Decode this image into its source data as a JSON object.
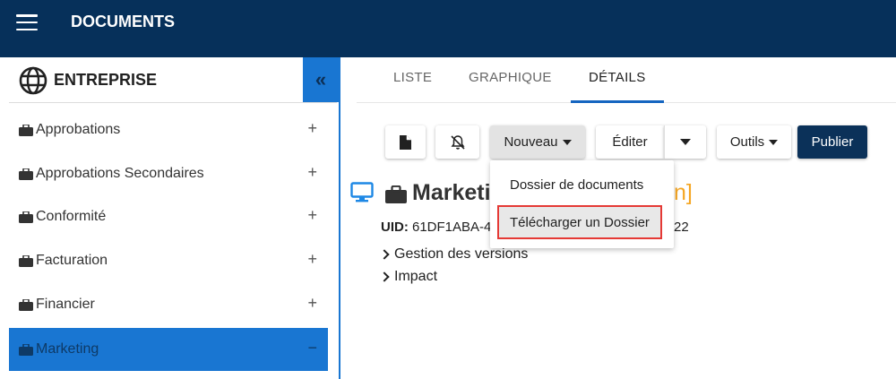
{
  "header": {
    "title": "DOCUMENTS",
    "menu_icon": "hamburger-icon"
  },
  "sidebar": {
    "title": "ENTREPRISE",
    "collapse_label": "«",
    "items": [
      {
        "label": "Approbations",
        "action": "+"
      },
      {
        "label": "Approbations Secondaires",
        "action": "+"
      },
      {
        "label": "Conformité",
        "action": "+"
      },
      {
        "label": "Facturation",
        "action": "+"
      },
      {
        "label": "Financier",
        "action": "+"
      },
      {
        "label": "Marketing",
        "action": "−",
        "active": true
      }
    ]
  },
  "tabs": [
    {
      "label": "LISTE"
    },
    {
      "label": "GRAPHIQUE"
    },
    {
      "label": "DÉTAILS",
      "active": true
    }
  ],
  "toolbar": {
    "new_label": "Nouveau",
    "edit_label": "Éditer",
    "tools_label": "Outils",
    "publish_label": "Publier"
  },
  "dropdown": {
    "items": [
      {
        "label": "Dossier de documents"
      },
      {
        "label": "Télécharger un Dossier",
        "highlighted": true
      }
    ]
  },
  "details": {
    "title": "Marketi",
    "bracket": "n]",
    "uid_label": "UID:",
    "uid_value": "61DF1ABA-4",
    "uid_tail": "22",
    "tree": [
      {
        "label": "Gestion des versions"
      },
      {
        "label": "Impact"
      }
    ]
  },
  "colors": {
    "topbar": "#06305a",
    "accent": "#1976d2",
    "publish": "#0b3159",
    "highlight_border": "#e53935",
    "bracket": "#f5a623"
  }
}
